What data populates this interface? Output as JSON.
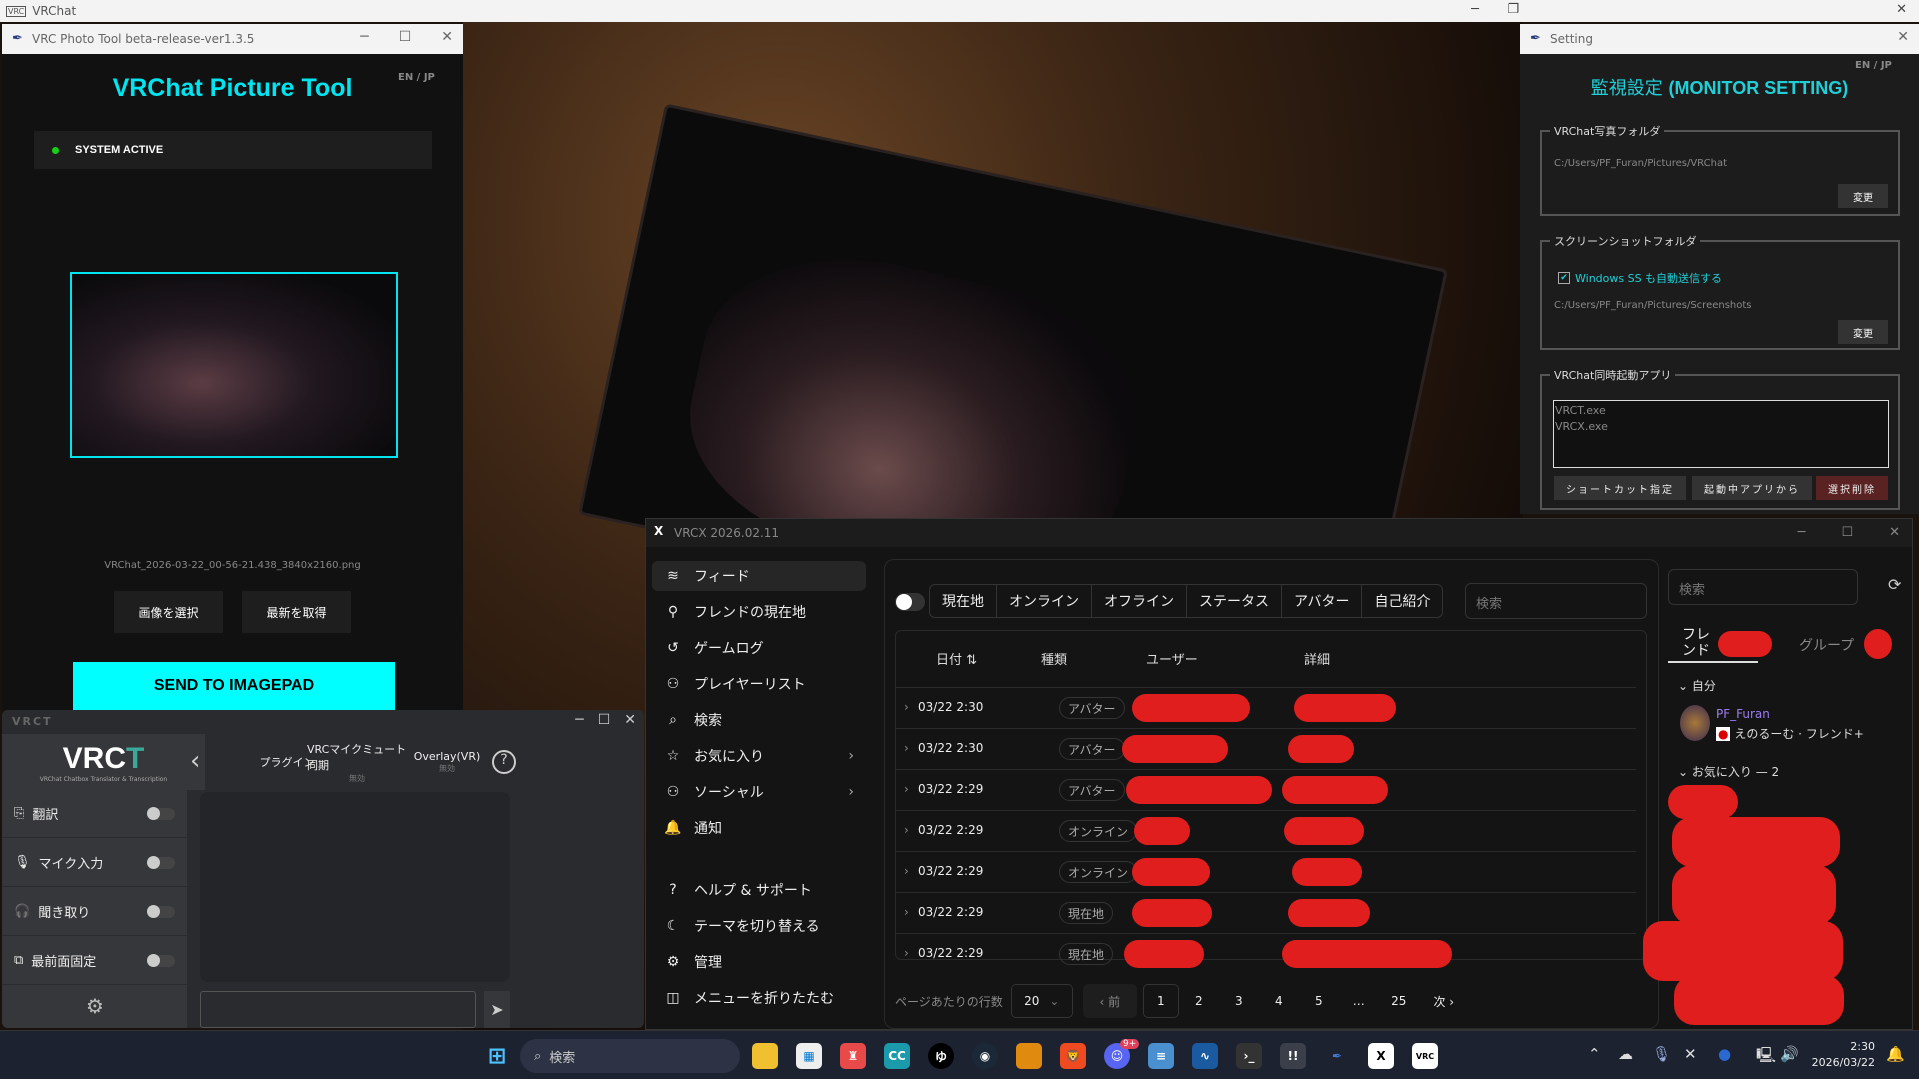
{
  "desktop": {
    "window_title": "VRChat"
  },
  "photo_tool": {
    "window_title": "VRC Photo Tool beta-release-ver1.3.5",
    "heading": "VRChat Picture Tool",
    "lang": "EN / JP",
    "status": "SYSTEM ACTIVE",
    "filename": "VRChat_2026-03-22_00-56-21.438_3840x2160.png",
    "select_image": "画像を選択",
    "get_latest": "最新を取得",
    "send": "SEND TO IMAGEPAD",
    "accent": "#00ffff"
  },
  "setting": {
    "window_title": "Setting",
    "title_jp": "監視設定",
    "title_en": "(MONITOR SETTING)",
    "lang": "EN / JP",
    "photo_folder": {
      "legend": "VRChat写真フォルダ",
      "path": "C:/Users/PF_Furan/Pictures/VRChat",
      "change": "変更"
    },
    "ss_folder": {
      "legend": "スクリーンショットフォルダ",
      "checkbox": "Windows SS も自動送信する",
      "checked": true,
      "path": "C:/Users/PF_Furan/Pictures/Screenshots",
      "change": "変更"
    },
    "apps": {
      "legend": "VRChat同時起動アプリ",
      "items": [
        "VRCT.exe",
        "VRCX.exe"
      ],
      "shortcut": "ショートカット指定",
      "from_running": "起動中アプリから",
      "delete": "選択削除"
    }
  },
  "vrct": {
    "window_title": "VRCT",
    "logo": "VRCT",
    "logo_sub": "VRChat Chatbox Translator & Transcription",
    "header": [
      {
        "label": "プラグイン",
        "sub": ""
      },
      {
        "label": "VRCマイクミュート同期",
        "sub": "無効"
      },
      {
        "label": "Overlay(VR)",
        "sub": "無効"
      }
    ],
    "items": [
      {
        "label": "翻訳",
        "on": false
      },
      {
        "label": "マイク入力",
        "on": false
      },
      {
        "label": "聞き取り",
        "on": false
      },
      {
        "label": "最前面固定",
        "on": false
      }
    ]
  },
  "vrcx": {
    "window_title": "VRCX 2026.02.11",
    "nav": [
      "フィード",
      "フレンドの現在地",
      "ゲームログ",
      "プレイヤーリスト",
      "検索",
      "お気に入り",
      "ソーシャル",
      "通知",
      "ヘルプ & サポート",
      "テーマを切り替える",
      "管理",
      "メニューを折りたたむ"
    ],
    "filters": [
      "現在地",
      "オンライン",
      "オフライン",
      "ステータス",
      "アバター",
      "自己紹介"
    ],
    "search_placeholder": "検索",
    "columns": [
      "日付",
      "種類",
      "ユーザー",
      "詳細"
    ],
    "rows": [
      {
        "date": "03/22 2:30",
        "type": "アバター"
      },
      {
        "date": "03/22 2:30",
        "type": "アバター"
      },
      {
        "date": "03/22 2:29",
        "type": "アバター"
      },
      {
        "date": "03/22 2:29",
        "type": "オンライン"
      },
      {
        "date": "03/22 2:29",
        "type": "オンライン"
      },
      {
        "date": "03/22 2:29",
        "type": "現在地"
      },
      {
        "date": "03/22 2:29",
        "type": "現在地"
      }
    ],
    "pager": {
      "rows_label": "ページあたりの行数",
      "rows_value": "20",
      "prev": "‹ 前",
      "pages": [
        "1",
        "2",
        "3",
        "4",
        "5",
        "…",
        "25"
      ],
      "next": "次 ›",
      "current": "1"
    },
    "right": {
      "search_placeholder": "検索",
      "tab_friends": "フレンド",
      "tab_groups": "グループ",
      "self_header": "自分",
      "self_name": "PF_Furan",
      "self_status": "えのるーむ · フレンド+",
      "fav_header": "お気に入り — 2"
    }
  },
  "taskbar": {
    "search": "検索",
    "time": "2:30",
    "date": "2026/03/22",
    "discord_badge": "9+"
  }
}
